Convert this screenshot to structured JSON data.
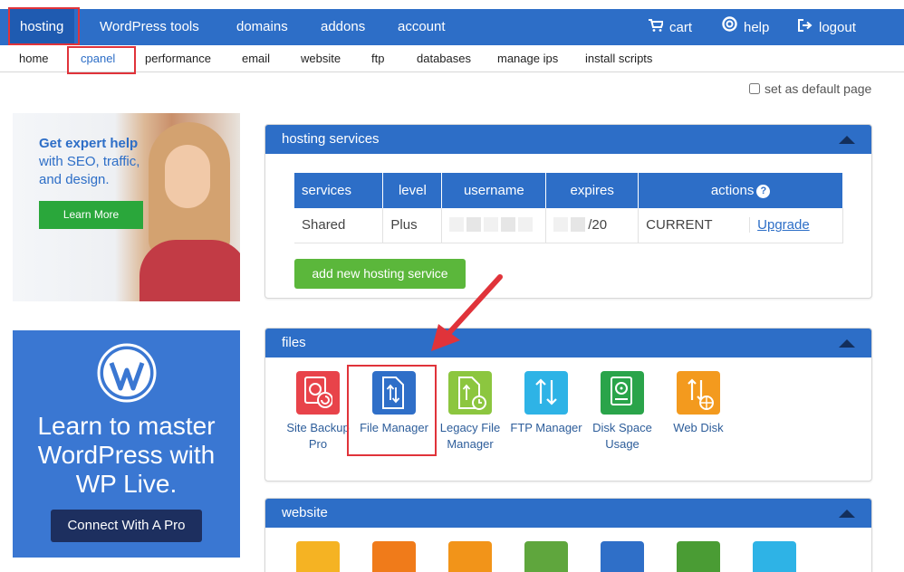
{
  "colors": {
    "brand": "#2d6ec7",
    "green": "#5bb73b",
    "highlight": "#e0333a"
  },
  "topnav": {
    "items": [
      {
        "label": "hosting",
        "active": true
      },
      {
        "label": "WordPress tools"
      },
      {
        "label": "domains"
      },
      {
        "label": "addons"
      },
      {
        "label": "account"
      }
    ],
    "right": [
      {
        "label": "cart",
        "icon": "cart-icon"
      },
      {
        "label": "help",
        "icon": "help-icon"
      },
      {
        "label": "logout",
        "icon": "logout-icon"
      }
    ]
  },
  "subnav": {
    "items": [
      {
        "label": "home"
      },
      {
        "label": "cpanel",
        "active": true
      },
      {
        "label": "performance"
      },
      {
        "label": "email"
      },
      {
        "label": "website"
      },
      {
        "label": "ftp"
      },
      {
        "label": "databases"
      },
      {
        "label": "manage ips"
      },
      {
        "label": "install scripts"
      }
    ]
  },
  "default_page_label": "set as default page",
  "ads": {
    "ad1": {
      "line1": "Get expert help",
      "line2": "with SEO, traffic,",
      "line3": "and design.",
      "button": "Learn More"
    },
    "ad2": {
      "line1": "Learn to master",
      "line2": "WordPress with",
      "line3": "WP Live.",
      "button": "Connect With A Pro"
    }
  },
  "hosting_services": {
    "title": "hosting services",
    "columns": [
      "services",
      "level",
      "username",
      "expires",
      "actions"
    ],
    "row": {
      "service": "Shared",
      "level": "Plus",
      "expires_suffix": "/20",
      "status": "CURRENT",
      "action": "Upgrade"
    },
    "add_button": "add new hosting service"
  },
  "files": {
    "title": "files",
    "icons": [
      {
        "line1": "Site Backup",
        "line2": "Pro",
        "color": "#e8434a",
        "icon": "backup-icon"
      },
      {
        "line1": "File Manager",
        "line2": "",
        "color": "#2f6fc8",
        "icon": "file-manager-icon",
        "highlighted": true
      },
      {
        "line1": "Legacy File",
        "line2": "Manager",
        "color": "#8cc63f",
        "icon": "legacy-file-manager-icon"
      },
      {
        "line1": "FTP Manager",
        "line2": "",
        "color": "#2eb3e6",
        "icon": "ftp-icon"
      },
      {
        "line1": "Disk Space",
        "line2": "Usage",
        "color": "#2aa44a",
        "icon": "disk-space-icon"
      },
      {
        "line1": "Web Disk",
        "line2": "",
        "color": "#f39a1e",
        "icon": "web-disk-icon"
      }
    ]
  },
  "website": {
    "title": "website",
    "icon_colors": [
      "#f5b323",
      "#f07b1a",
      "#f29419",
      "#5fa63d",
      "#2f6fc8",
      "#4a9c34",
      "#2eb3e6"
    ],
    "icon_names": [
      "sitebuilder-icon",
      "wordpress-install-icon",
      "wordpress-icon",
      "download-icon",
      "security-icon",
      "wordpress-backup-icon",
      "globe-icon"
    ]
  }
}
